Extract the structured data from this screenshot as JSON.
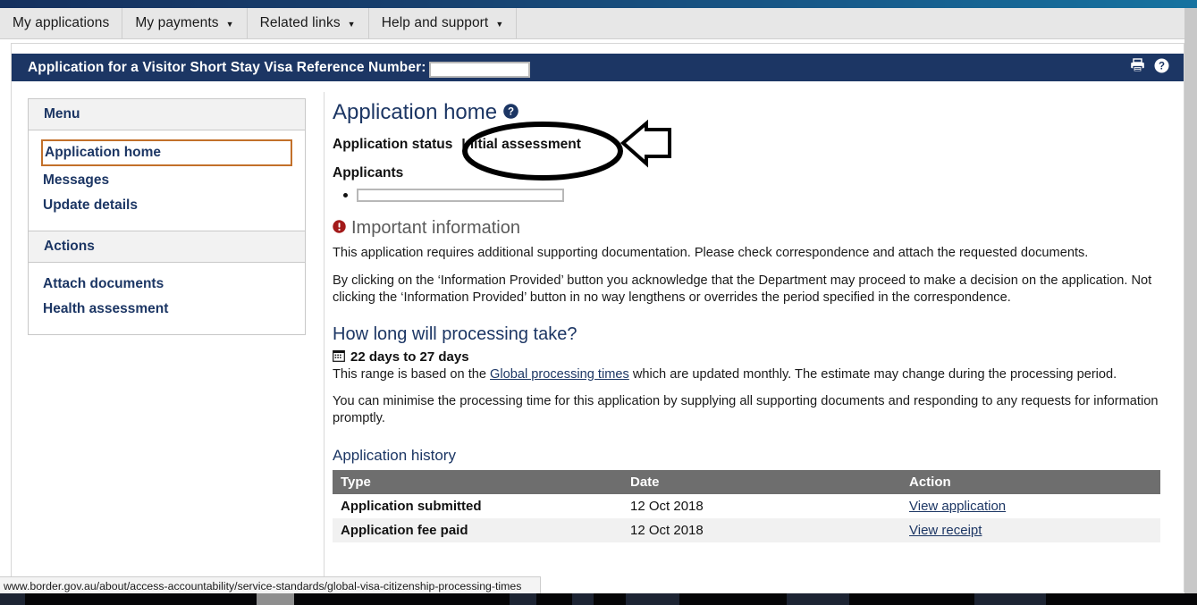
{
  "navbar": {
    "items": [
      {
        "label": "My applications",
        "caret": false
      },
      {
        "label": "My payments",
        "caret": true
      },
      {
        "label": "Related links",
        "caret": true
      },
      {
        "label": "Help and support",
        "caret": true
      }
    ],
    "caret_glyph": "▼"
  },
  "banner": {
    "title": "Application for a Visitor Short Stay Visa Reference Number:",
    "reference_value": "",
    "print_icon": "printer-icon",
    "help_icon": "help-circle-icon"
  },
  "sidebar": {
    "menu_header": "Menu",
    "menu_items": [
      {
        "label": "Application home",
        "active": true
      },
      {
        "label": "Messages",
        "active": false
      },
      {
        "label": "Update details",
        "active": false
      }
    ],
    "actions_header": "Actions",
    "action_items": [
      {
        "label": "Attach documents"
      },
      {
        "label": "Health assessment"
      }
    ],
    "active_outline_color": "#c2702a"
  },
  "main": {
    "page_title": "Application home",
    "page_title_help_icon": "help-circle-icon",
    "status_label": "Application status",
    "status_value": "Initial assessment",
    "applicants_label": "Applicants",
    "applicant_redacted": "",
    "important": {
      "icon": "alert-exclamation-icon",
      "heading": "Important information",
      "paragraph1": "This application requires additional supporting documentation. Please check correspondence and attach the requested documents.",
      "paragraph2": "By clicking on the ‘Information Provided’ button you acknowledge that the Department may proceed to make a decision on the application. Not clicking the ‘Information Provided’ button in no way lengthens or overrides the period specified in the correspondence."
    },
    "processing": {
      "heading": "How long will processing take?",
      "calendar_icon": "calendar-icon",
      "days_range": "22 days to 27 days",
      "range_text_before": "This range is based on the ",
      "range_link": "Global processing times",
      "range_text_after": " which are updated monthly. The estimate may change during the processing period.",
      "minimise_text": "You can minimise the processing time for this application by supplying all supporting documents and responding to any requests for information promptly."
    },
    "history": {
      "heading": "Application history",
      "columns": [
        "Type",
        "Date",
        "Action"
      ],
      "rows": [
        {
          "type": "Application submitted",
          "date": "12 Oct 2018",
          "action": "View application"
        },
        {
          "type": "Application fee paid",
          "date": "12 Oct 2018",
          "action": "View receipt"
        }
      ]
    }
  },
  "annotation": {
    "ellipse_around": "Initial assessment",
    "arrow_direction": "left",
    "stroke_color": "#000000"
  },
  "statusbar": {
    "url": "www.border.gov.au/about/access-accountability/service-standards/global-visa-citizenship-processing-times"
  },
  "colors": {
    "navy": "#1c3664",
    "table_header_gray": "#6e6e6e",
    "alert_red": "#a31a1a",
    "accent_orange": "#c2702a"
  }
}
